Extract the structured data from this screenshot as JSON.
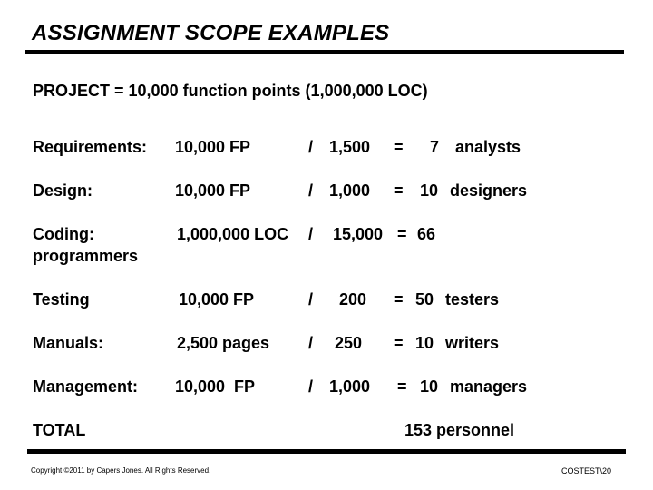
{
  "slide": {
    "title": "ASSIGNMENT SCOPE EXAMPLES",
    "subtitle": "PROJECT = 10,000 function points (1,000,000  LOC)",
    "rows": [
      {
        "label": "Requirements:",
        "quantity": "10,000 FP",
        "divider": "/",
        "scope": "1,500",
        "equals": "=",
        "result": "7",
        "role": "analysts"
      },
      {
        "label": "Design:",
        "quantity": "10,000 FP",
        "divider": "/",
        "scope": "1,000",
        "equals": "=",
        "result": "10",
        "role": "designers"
      },
      {
        "label": "Coding:",
        "label_line2": "programmers",
        "quantity": "1,000,000 LOC",
        "divider": "/",
        "scope": "15,000",
        "equals": "=",
        "result": "66",
        "role": ""
      },
      {
        "label": "Testing",
        "quantity": "10,000 FP",
        "divider": "/",
        "scope": "200",
        "equals": "=",
        "result": "50",
        "role": "testers"
      },
      {
        "label": "Manuals:",
        "quantity": "2,500 pages",
        "divider": "/",
        "scope": "250",
        "equals": "=",
        "result": "10",
        "role": "writers"
      },
      {
        "label": "Management:",
        "quantity": "10,000  FP",
        "divider": "/",
        "scope": "1,000",
        "equals": "=",
        "result": "10",
        "role": "managers"
      }
    ],
    "total": {
      "label": "TOTAL",
      "value": "153 personnel"
    },
    "footer": {
      "copyright": "Copyright ©2011 by Capers Jones.  All Rights Reserved.",
      "slide_id": "COSTEST\\20"
    }
  }
}
